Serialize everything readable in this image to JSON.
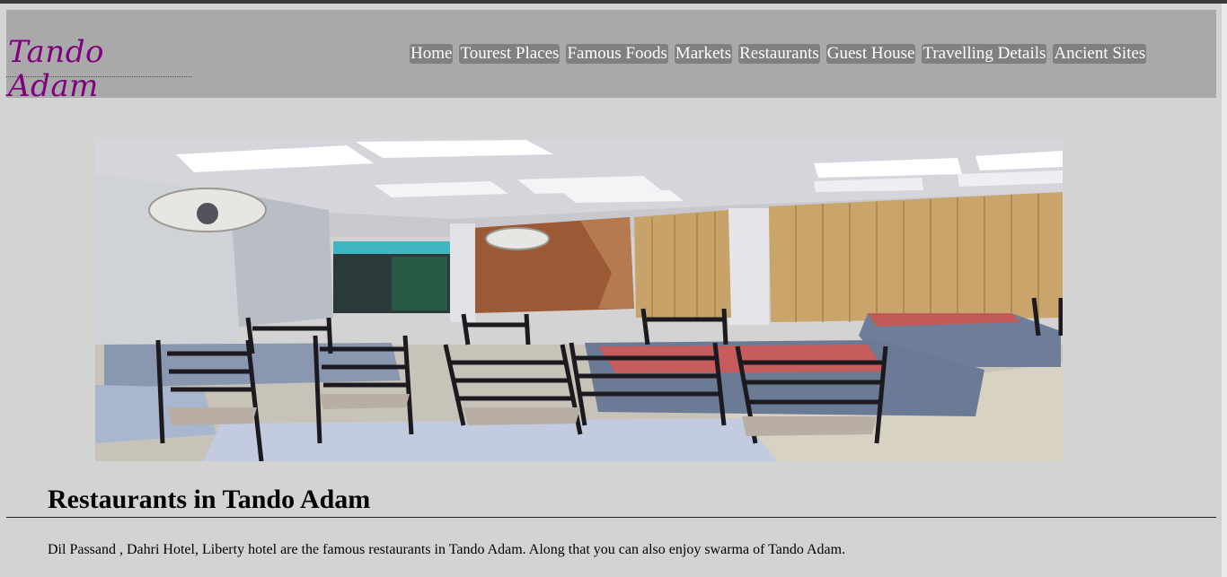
{
  "site": {
    "logo_text": "Tando Adam"
  },
  "nav": {
    "items": [
      {
        "label": "Home"
      },
      {
        "label": "Tourest Places"
      },
      {
        "label": "Famous Foods"
      },
      {
        "label": "Markets"
      },
      {
        "label": "Restaurants"
      },
      {
        "label": "Guest House"
      },
      {
        "label": "Travelling Details"
      },
      {
        "label": "Ancient Sites"
      }
    ]
  },
  "main": {
    "title": "Restaurants in Tando Adam",
    "description": "Dil Passand , Dahri Hotel, Liberty hotel are the famous restaurants in Tando Adam. Along that you can also enjoy swarma of Tando Adam."
  },
  "colors": {
    "page_bg": "#d3d3d3",
    "header_bg": "#a9a9a9",
    "nav_bg": "#808080",
    "logo": "#800080"
  }
}
